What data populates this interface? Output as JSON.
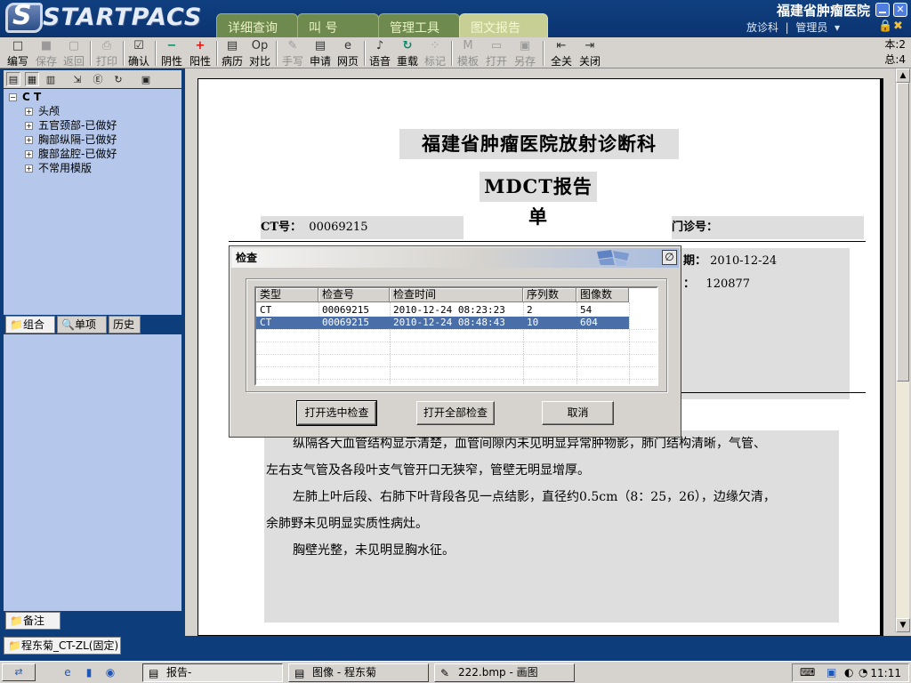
{
  "app": {
    "logo_text": "STARTPACS",
    "hospital": "福建省肿瘤医院",
    "department": "放诊科",
    "user": "管理员"
  },
  "main_tabs": [
    "详细查询",
    "叫 号",
    "管理工具",
    "图文报告"
  ],
  "toolbar": {
    "items": [
      {
        "label": "编写",
        "icon": "□"
      },
      {
        "label": "保存",
        "icon": "■"
      },
      {
        "label": "返回",
        "icon": "▢"
      },
      {
        "label": "打印",
        "icon": "⎙"
      },
      {
        "label": "确认",
        "icon": "☑"
      },
      {
        "label": "阴性",
        "icon": "−"
      },
      {
        "label": "阳性",
        "icon": "+"
      },
      {
        "label": "病历",
        "icon": "▤"
      },
      {
        "label": "对比",
        "icon": "Op"
      },
      {
        "label": "手写",
        "icon": "✎"
      },
      {
        "label": "申请",
        "icon": "▤"
      },
      {
        "label": "网页",
        "icon": "e"
      },
      {
        "label": "语音",
        "icon": "♪"
      },
      {
        "label": "重载",
        "icon": "↻"
      },
      {
        "label": "标记",
        "icon": "⁘"
      },
      {
        "label": "模板",
        "icon": "M"
      },
      {
        "label": "打开",
        "icon": "▭"
      },
      {
        "label": "另存",
        "icon": "▣"
      },
      {
        "label": "全关",
        "icon": "⇤"
      },
      {
        "label": "关闭",
        "icon": "⇥"
      }
    ],
    "page_current": "本:2",
    "page_total": "总:4"
  },
  "tree": {
    "root": "C T",
    "items": [
      "头颅",
      "五官颈部-已做好",
      "胸部纵隔-已做好",
      "腹部盆腔-已做好",
      "不常用模版"
    ]
  },
  "left_tabs": [
    "组合",
    "单项",
    "历史"
  ],
  "notes_tab": "备注",
  "report": {
    "title": "福建省肿瘤医院放射诊断科",
    "subtitle": "MDCT报告单",
    "ct_label": "CT号：",
    "ct_no": "00069215",
    "clinic_label": "门诊号：",
    "clinic_no": "",
    "date_label": "期：",
    "date": "2010-12-24",
    "field_label": "：",
    "field_value": "120877",
    "para_partial": "纵隔各大血管结构显示清楚，血管间隙内未见明显异常肿物影，肺门结构清晰，气管、",
    "para1b": "左右支气管及各段叶支气管开口无狭窄，管壁无明显增厚。",
    "para2a": "左肺上叶后段、右肺下叶背段各见一点结影，直径约0.5cm（8：25，26），边缘欠清，",
    "para2b": "余肺野未见明显实质性病灶。",
    "para3": "胸壁光整，未见明显胸水征。"
  },
  "dialog": {
    "title": "检查",
    "columns": [
      "类型",
      "检查号",
      "检查时间",
      "序列数",
      "图像数"
    ],
    "rows": [
      {
        "type": "CT",
        "exam_no": "00069215",
        "time": "2010-12-24 08:23:23",
        "series": "2",
        "images": "54"
      },
      {
        "type": "CT",
        "exam_no": "00069215",
        "time": "2010-12-24 08:48:43",
        "series": "10",
        "images": "604"
      }
    ],
    "selected_row": 1,
    "btn_open_selected": "打开选中检查",
    "btn_open_all": "打开全部检查",
    "btn_cancel": "取消"
  },
  "status_tab": "程东菊_CT-ZL(固定)",
  "taskbar": {
    "tasks": [
      "报告-",
      "图像 - 程东菊",
      "222.bmp - 画图"
    ],
    "clock": "11:11"
  },
  "colors": {
    "frame_blue": "#0d3d7a",
    "tree_bg": "#b5c7ea",
    "tab_green": "#6e8a4f",
    "selection": "#4a6fa8",
    "positive_red": "#e01010"
  }
}
